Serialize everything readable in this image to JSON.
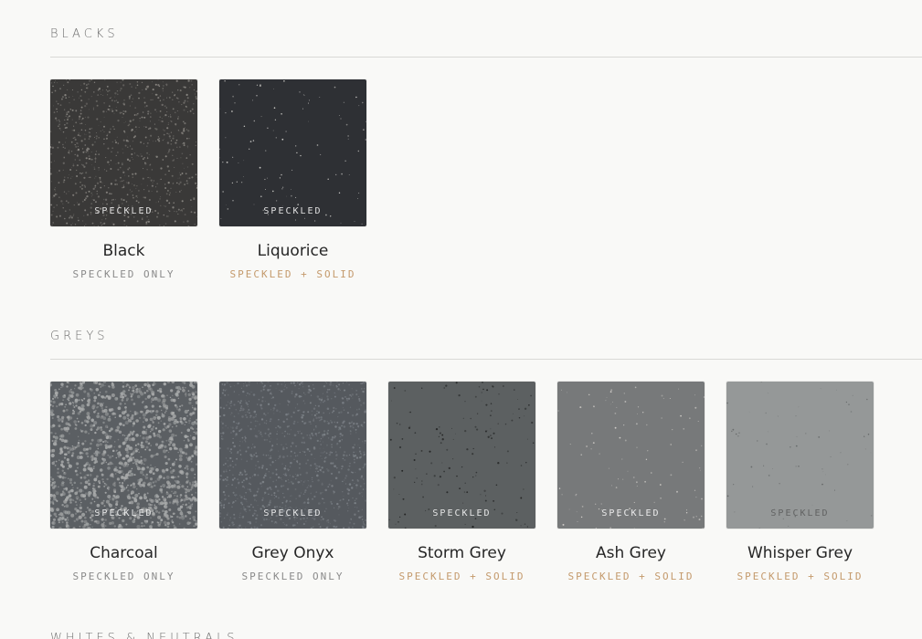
{
  "sections": [
    {
      "title": "BLACKS",
      "swatches": [
        {
          "name": "Black",
          "badge": "SPECKLED",
          "finish": "SPECKLED ONLY",
          "both": false,
          "base": "#3a3938",
          "speck": "#8d8a85",
          "density": 900,
          "speckSize": 0.9
        },
        {
          "name": "Liquorice",
          "badge": "SPECKLED",
          "finish": "SPECKLED + SOLID",
          "both": true,
          "base": "#2e3034",
          "speck": "#e2e0dc",
          "density": 110,
          "speckSize": 0.7
        }
      ]
    },
    {
      "title": "GREYS",
      "swatches": [
        {
          "name": "Charcoal",
          "badge": "SPECKLED",
          "finish": "SPECKLED ONLY",
          "both": false,
          "base": "#5b5f63",
          "speck": "#a9abab",
          "density": 1400,
          "speckSize": 1.6
        },
        {
          "name": "Grey Onyx",
          "badge": "SPECKLED",
          "finish": "SPECKLED ONLY",
          "both": false,
          "base": "#55595e",
          "speck": "#7d8288",
          "density": 1100,
          "speckSize": 1.0
        },
        {
          "name": "Storm Grey",
          "badge": "SPECKLED",
          "finish": "SPECKLED + SOLID",
          "both": true,
          "base": "#5c6061",
          "speck": "#1f2020",
          "density": 150,
          "speckSize": 0.9
        },
        {
          "name": "Ash Grey",
          "badge": "SPECKLED",
          "finish": "SPECKLED + SOLID",
          "both": true,
          "base": "#77797a",
          "speck": "#d7d4cf",
          "density": 110,
          "speckSize": 0.8
        },
        {
          "name": "Whisper Grey",
          "badge": "SPECKLED",
          "finish": "SPECKLED + SOLID",
          "both": true,
          "base": "#959898",
          "speck": "#5c5f5f",
          "density": 60,
          "speckSize": 0.7,
          "darkBadge": true
        }
      ]
    },
    {
      "title": "WHITES & NEUTRALS",
      "swatches": []
    }
  ]
}
